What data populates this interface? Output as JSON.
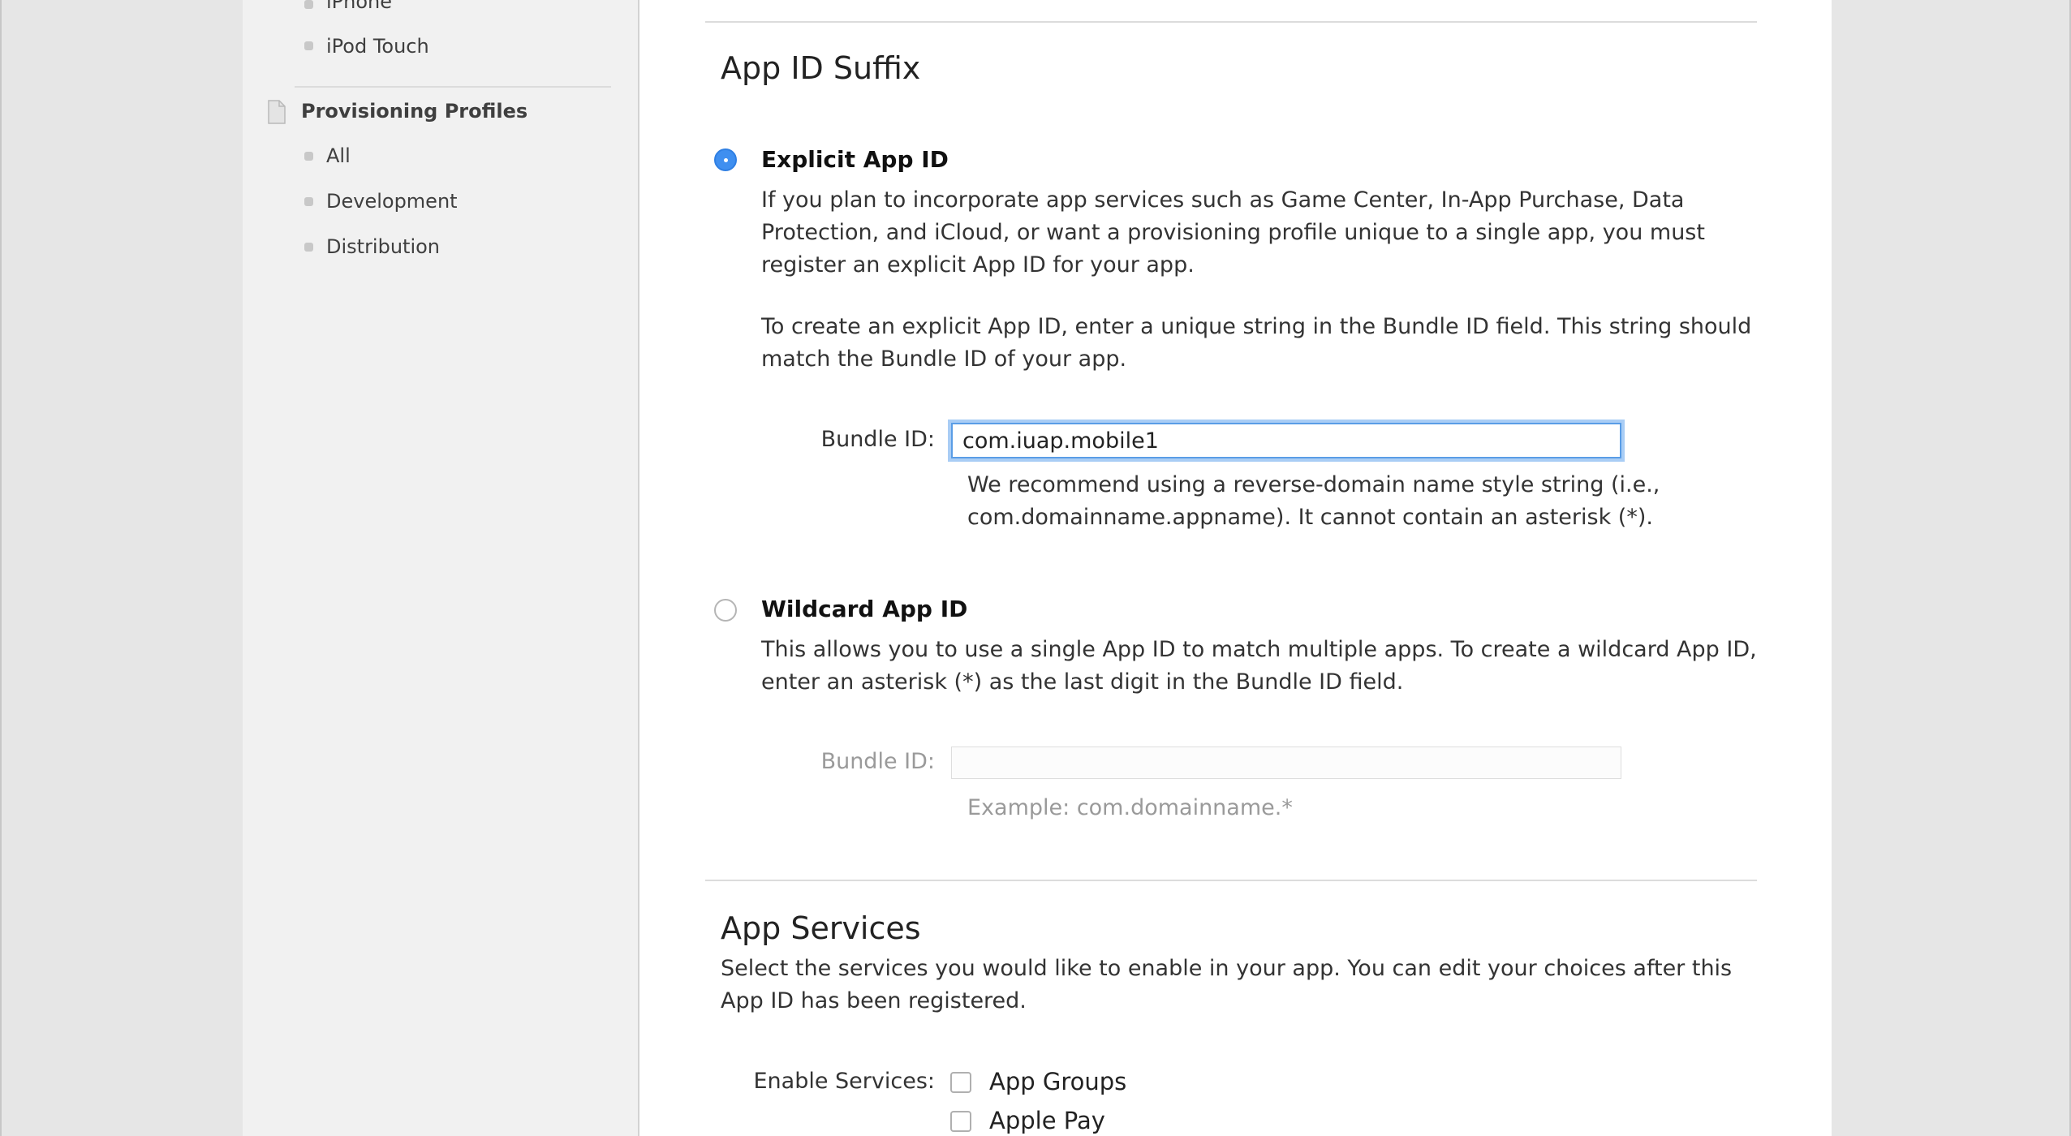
{
  "sidebar": {
    "devices": [
      {
        "label": "iPhone"
      },
      {
        "label": "iPod Touch"
      }
    ],
    "provisioning": {
      "heading": "Provisioning Profiles",
      "icon": "document-icon",
      "items": [
        {
          "label": "All"
        },
        {
          "label": "Development"
        },
        {
          "label": "Distribution"
        }
      ]
    }
  },
  "suffix": {
    "title": "App ID Suffix",
    "explicit": {
      "selected": true,
      "title": "Explicit App ID",
      "description": "If you plan to incorporate app services such as Game Center, In-App Purchase, Data Protection, and iCloud, or want a provisioning profile unique to a single app, you must register an explicit App ID for your app.",
      "instructions": "To create an explicit App ID, enter a unique string in the Bundle ID field. This string should match the Bundle ID of your app.",
      "bundle_label": "Bundle ID:",
      "bundle_value": "com.iuap.mobile1",
      "hint": "We recommend using a reverse-domain name style string (i.e., com.domainname.appname). It cannot contain an asterisk (*)."
    },
    "wildcard": {
      "selected": false,
      "title": "Wildcard App ID",
      "description": "This allows you to use a single App ID to match multiple apps. To create a wildcard App ID, enter an asterisk (*) as the last digit in the Bundle ID field.",
      "bundle_label": "Bundle ID:",
      "bundle_value": "",
      "example": "Example: com.domainname.*"
    }
  },
  "services": {
    "title": "App Services",
    "description": "Select the services you would like to enable in your app. You can edit your choices after this App ID has been registered.",
    "enable_label": "Enable Services:",
    "items": [
      {
        "label": "App Groups",
        "checked": false
      },
      {
        "label": "Apple Pay",
        "checked": false
      }
    ]
  },
  "colors": {
    "accent": "#3f8ff0",
    "focus_ring": "#a9cdf5",
    "sidebar_bg": "#f1f1f1",
    "backdrop": "#e6e6e6"
  }
}
